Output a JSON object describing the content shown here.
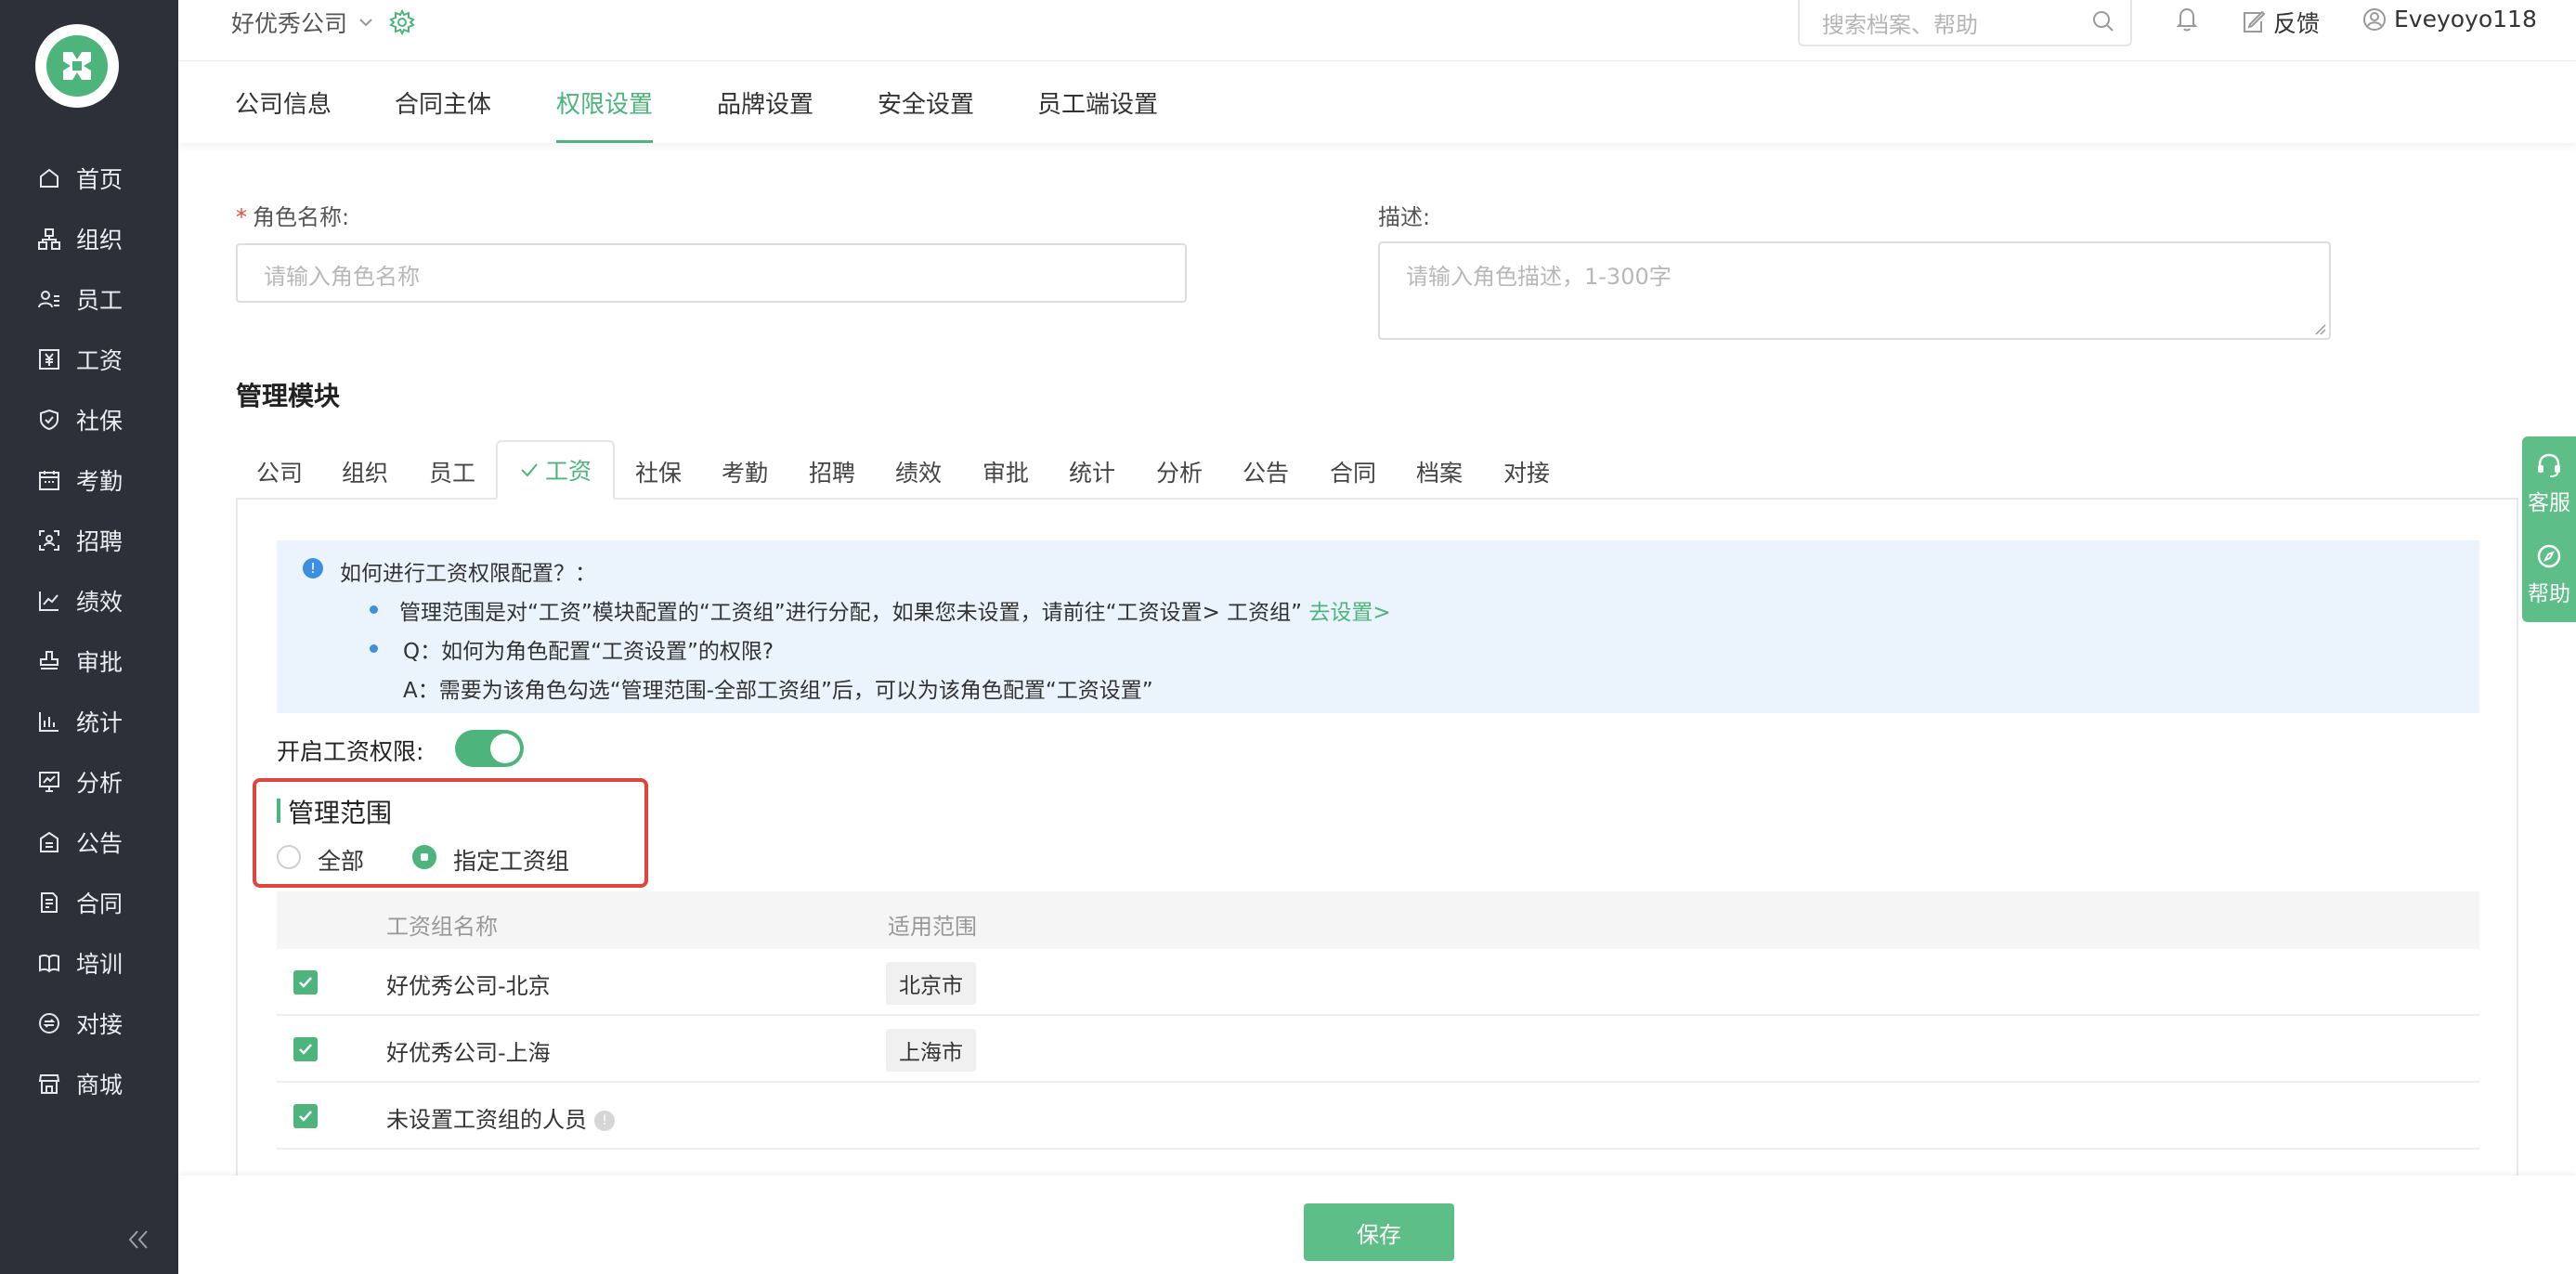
{
  "brand": {
    "accent": "#4db47b",
    "sidebar_bg": "#2d3039",
    "highlight_border": "#e0443a"
  },
  "sidebar": {
    "items": [
      {
        "label": "首页",
        "icon": "home-icon"
      },
      {
        "label": "组织",
        "icon": "org-icon"
      },
      {
        "label": "员工",
        "icon": "employee-icon"
      },
      {
        "label": "工资",
        "icon": "salary-icon"
      },
      {
        "label": "社保",
        "icon": "social-security-icon"
      },
      {
        "label": "考勤",
        "icon": "attendance-icon"
      },
      {
        "label": "招聘",
        "icon": "recruit-icon"
      },
      {
        "label": "绩效",
        "icon": "performance-icon"
      },
      {
        "label": "审批",
        "icon": "approval-icon"
      },
      {
        "label": "统计",
        "icon": "stats-icon"
      },
      {
        "label": "分析",
        "icon": "analysis-icon"
      },
      {
        "label": "公告",
        "icon": "announcement-icon"
      },
      {
        "label": "合同",
        "icon": "contract-icon"
      },
      {
        "label": "培训",
        "icon": "training-icon"
      },
      {
        "label": "对接",
        "icon": "integration-icon"
      },
      {
        "label": "商城",
        "icon": "store-icon"
      }
    ]
  },
  "header": {
    "company": "好优秀公司",
    "search_placeholder": "搜索档案、帮助",
    "feedback": "反馈",
    "username": "Eveyoyo118"
  },
  "top_tabs": [
    "公司信息",
    "合同主体",
    "权限设置",
    "品牌设置",
    "安全设置",
    "员工端设置"
  ],
  "top_tab_active": "权限设置",
  "form": {
    "role_label": "角色名称:",
    "role_placeholder": "请输入角色名称",
    "desc_label": "描述:",
    "desc_placeholder": "请输入角色描述，1-300字"
  },
  "module": {
    "title": "管理模块",
    "tabs": [
      "公司",
      "组织",
      "员工",
      "工资",
      "社保",
      "考勤",
      "招聘",
      "绩效",
      "审批",
      "统计",
      "分析",
      "公告",
      "合同",
      "档案",
      "对接"
    ],
    "active": "工资"
  },
  "info": {
    "title": "如何进行工资权限配置？：",
    "line1": "管理范围是对“工资”模块配置的“工资组”进行分配，如果您未设置，请前往“工资设置> 工资组”",
    "line1_link": "去设置>",
    "line2": "Q：如何为角色配置“工资设置”的权限?",
    "line3": "A：需要为该角色勾选“管理范围-全部工资组”后，可以为该角色配置“工资设置”"
  },
  "toggle": {
    "label": "开启工资权限:",
    "on": true
  },
  "scope": {
    "title": "管理范围",
    "options": [
      "全部",
      "指定工资组"
    ],
    "selected": "指定工资组"
  },
  "table": {
    "columns": [
      "工资组名称",
      "适用范围"
    ],
    "rows": [
      {
        "checked": true,
        "name": "好优秀公司-北京",
        "scope": "北京市"
      },
      {
        "checked": true,
        "name": "好优秀公司-上海",
        "scope": "上海市"
      },
      {
        "checked": true,
        "name": "未设置工资组的人员",
        "scope": ""
      }
    ]
  },
  "footer": {
    "save": "保存"
  },
  "float": {
    "service": "客服",
    "help": "帮助"
  }
}
